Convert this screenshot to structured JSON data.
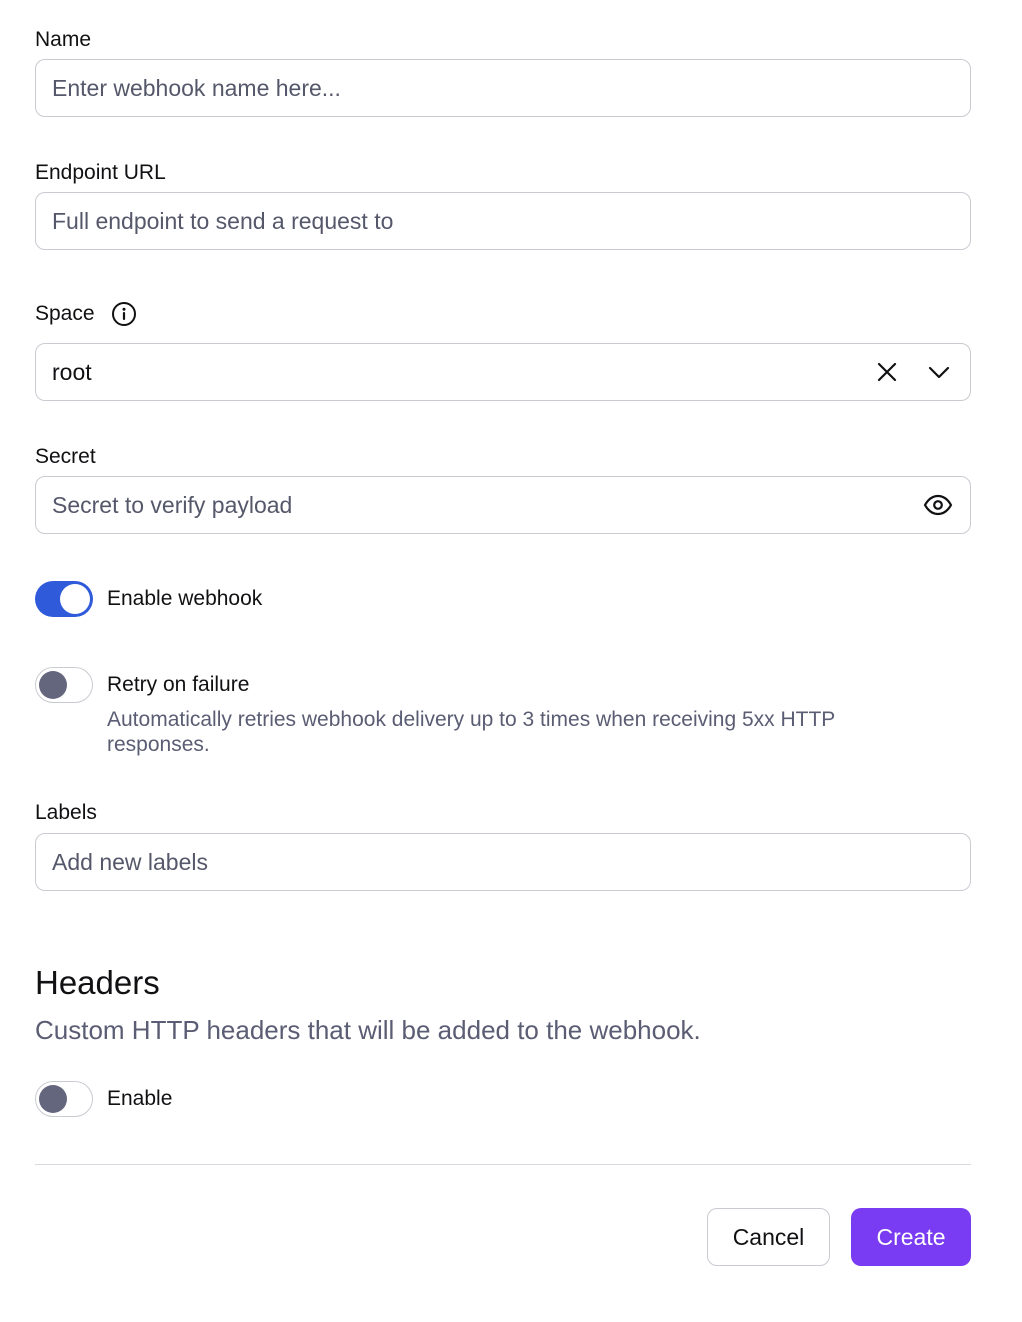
{
  "form": {
    "name": {
      "label": "Name",
      "placeholder": "Enter webhook name here..."
    },
    "endpoint": {
      "label": "Endpoint URL",
      "placeholder": "Full endpoint to send a request to"
    },
    "space": {
      "label": "Space",
      "value": "root",
      "info_icon": "info-icon",
      "clear_icon": "close-icon",
      "dropdown_icon": "chevron-down-icon"
    },
    "secret": {
      "label": "Secret",
      "placeholder": "Secret to verify payload",
      "reveal_icon": "eye-icon"
    },
    "enable_webhook": {
      "label": "Enable webhook",
      "on": true
    },
    "retry": {
      "label": "Retry on failure",
      "on": false,
      "help": "Automatically retries webhook delivery up to 3 times when receiving 5xx HTTP",
      "help_line2": "responses."
    },
    "labels": {
      "label": "Labels",
      "placeholder": "Add new labels"
    }
  },
  "headers": {
    "title": "Headers",
    "subtitle": "Custom HTTP headers that will be added to the webhook.",
    "enable_label": "Enable",
    "on": false
  },
  "actions": {
    "cancel_label": "Cancel",
    "create_label": "Create"
  },
  "colors": {
    "accent_toggle": "#2f5bdb",
    "primary_button": "#7a3cf2"
  }
}
